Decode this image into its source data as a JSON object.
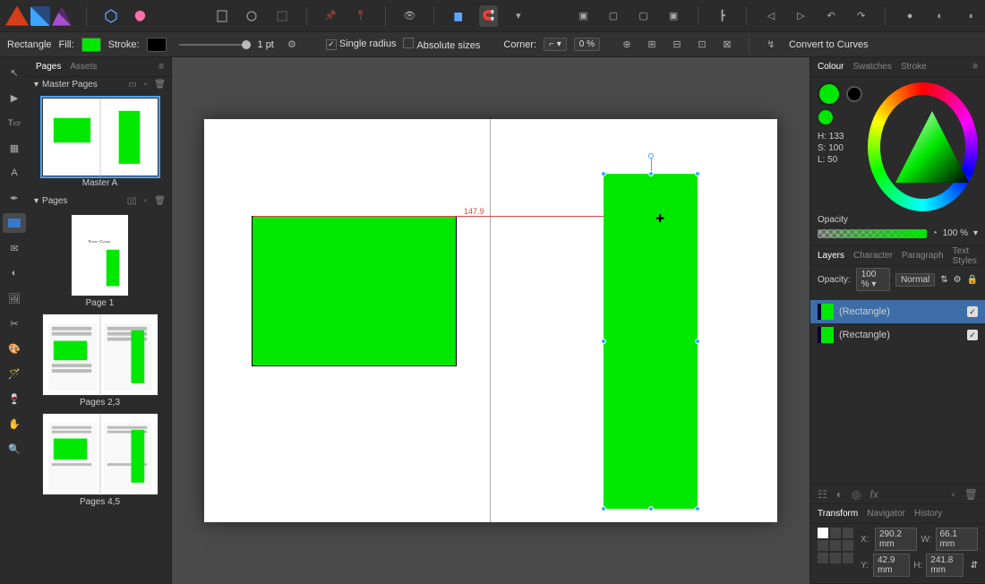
{
  "context_tool": "Rectangle",
  "fill_label": "Fill:",
  "stroke_label": "Stroke:",
  "stroke_weight": "1 pt",
  "single_radius": "Single radius",
  "absolute_sizes": "Absolute sizes",
  "corner_label": "Corner:",
  "corner_pct": "0 %",
  "convert_curves": "Convert to Curves",
  "panels": {
    "pages_tab": "Pages",
    "assets_tab": "Assets",
    "master_pages": "Master Pages",
    "pages": "Pages",
    "master_a": "Master A",
    "page1": "Page 1",
    "pages23": "Pages 2,3",
    "pages45": "Pages 4,5"
  },
  "front_cover_text": "Front Cover",
  "guide_value": "147.9",
  "colour": {
    "tab_colour": "Colour",
    "tab_swatches": "Swatches",
    "tab_stroke": "Stroke",
    "h": "H: 133",
    "s": "S: 100",
    "l": "L: 50",
    "opacity_label": "Opacity",
    "opacity_val": "100 %"
  },
  "layers": {
    "tab_layers": "Layers",
    "tab_character": "Character",
    "tab_paragraph": "Paragraph",
    "tab_text_styles": "Text Styles",
    "opacity_label": "Opacity:",
    "opacity_val": "100 %",
    "blend": "Normal",
    "layer1": "(Rectangle)",
    "layer2": "(Rectangle)"
  },
  "transform": {
    "tab_transform": "Transform",
    "tab_navigator": "Navigator",
    "tab_history": "History",
    "x_lbl": "X:",
    "x": "290.2 mm",
    "w_lbl": "W:",
    "w": "66.1 mm",
    "y_lbl": "Y:",
    "y": "42.9 mm",
    "h_lbl": "H:",
    "h": "241.8 mm"
  }
}
